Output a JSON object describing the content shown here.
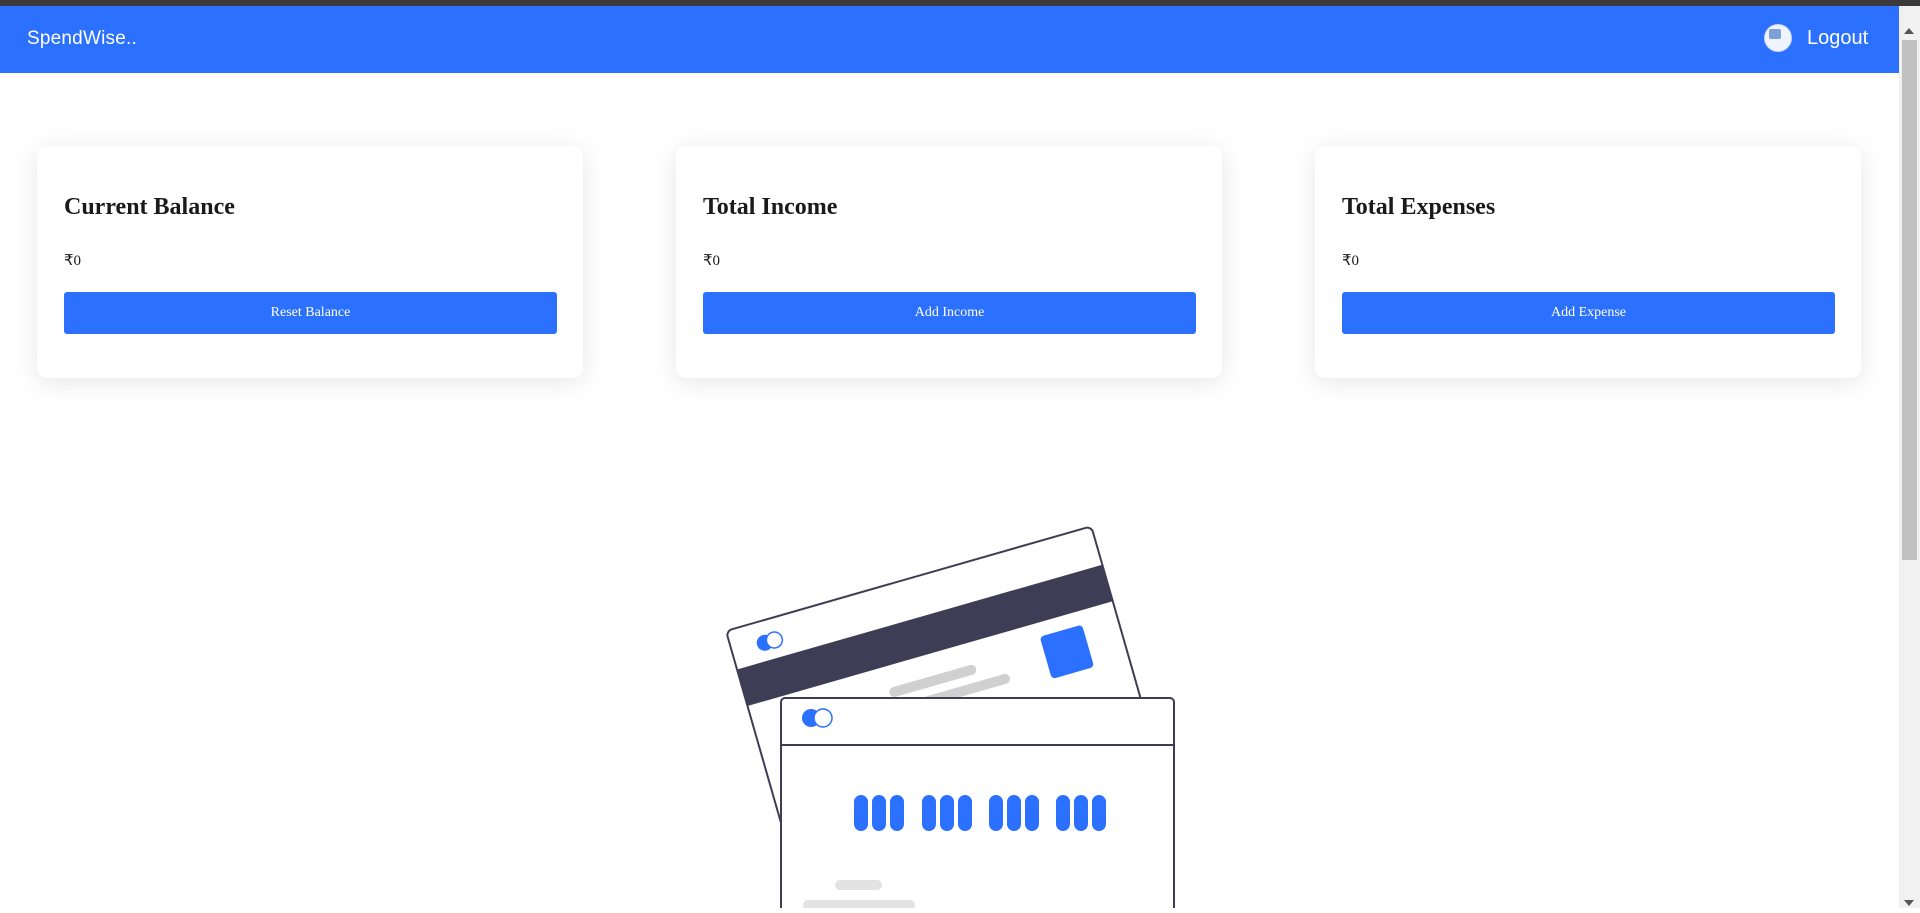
{
  "navbar": {
    "brand": "SpendWise..",
    "avatar_icon": "user-avatar-icon",
    "logout_label": "Logout",
    "color": "#2b70ff"
  },
  "cards": [
    {
      "title": "Current Balance",
      "amount": "₹0",
      "button_label": "Reset Balance"
    },
    {
      "title": "Total Income",
      "amount": "₹0",
      "button_label": "Add Income"
    },
    {
      "title": "Total Expenses",
      "amount": "₹0",
      "button_label": "Add Expense"
    }
  ],
  "illustration": {
    "icon": "credit-cards-illustration",
    "colors": {
      "accent": "#2b70ff",
      "dark": "#3f3d56",
      "muted": "#d0d0d0"
    }
  }
}
